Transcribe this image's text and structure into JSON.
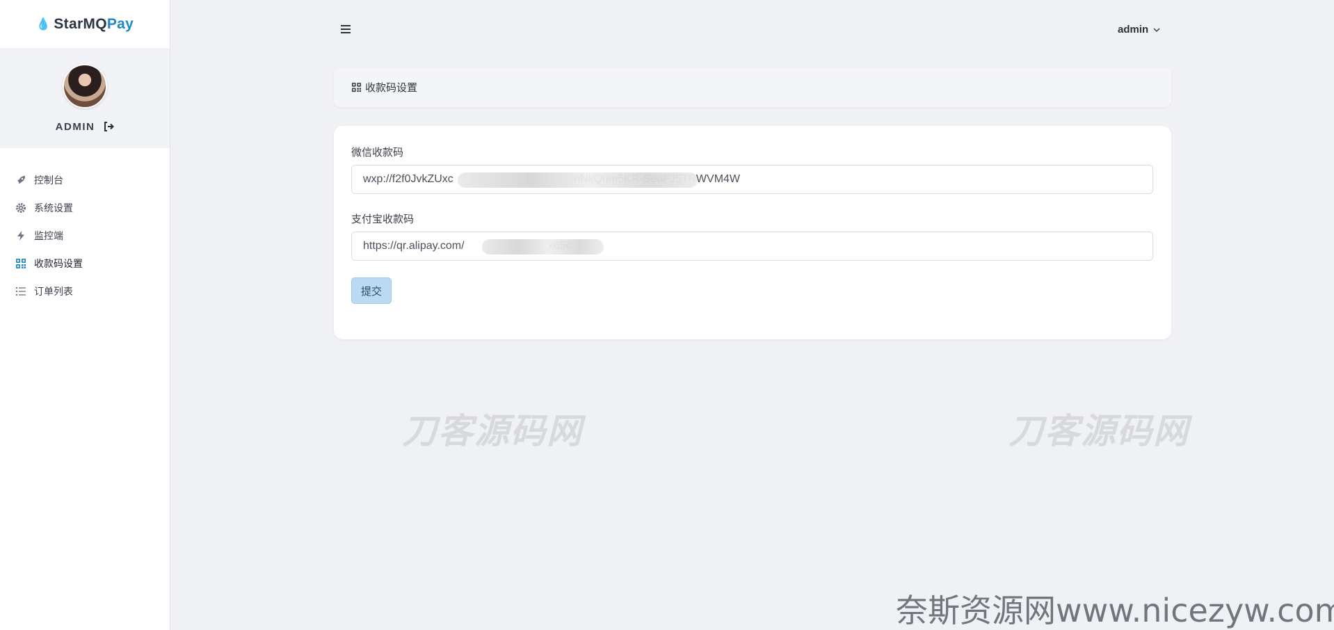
{
  "brand": {
    "part1": "StarMQ",
    "part2": "Pay",
    "accent": "#1e88c8"
  },
  "profile": {
    "name": "ADMIN"
  },
  "sidebar": {
    "items": [
      {
        "label": "控制台",
        "icon": "rocket-icon"
      },
      {
        "label": "系统设置",
        "icon": "gear-icon"
      },
      {
        "label": "监控端",
        "icon": "bolt-icon"
      },
      {
        "label": "收款码设置",
        "icon": "qrcode-icon"
      },
      {
        "label": "订单列表",
        "icon": "list-icon"
      }
    ]
  },
  "header": {
    "user": "admin"
  },
  "page": {
    "title": "收款码设置"
  },
  "form": {
    "wechat_label": "微信收款码",
    "wechat_value": "wxp://f2f0JvkZUxc                                       nNkQum5KR-SeuFJ5TRWVM4W",
    "alipay_label": "支付宝收款码",
    "alipay_value": "https://qr.alipay.com/                           x65c",
    "submit_label": "提交"
  },
  "watermarks": {
    "center": "刀客源码网",
    "corner": "奈斯资源网www.nicezyw.com"
  }
}
